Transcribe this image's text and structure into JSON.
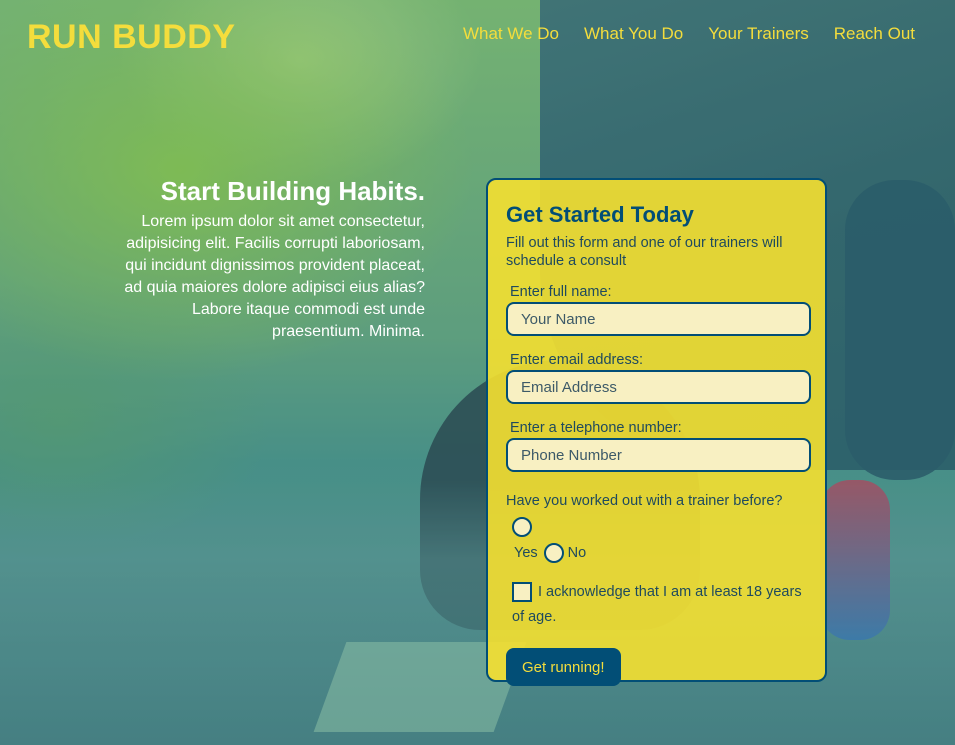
{
  "brand": {
    "logo": "RUN BUDDY"
  },
  "nav": [
    {
      "label": "What We Do"
    },
    {
      "label": "What You Do"
    },
    {
      "label": "Your Trainers"
    },
    {
      "label": "Reach Out"
    }
  ],
  "hero": {
    "title": "Start Building Habits.",
    "body": "Lorem ipsum dolor sit amet consectetur, adipisicing elit. Facilis corrupti laboriosam, qui incidunt dignissimos provident placeat, ad quia maiores dolore adipisci eius alias? Labore itaque commodi est unde praesentium. Minima."
  },
  "form": {
    "title": "Get Started Today",
    "subtitle": "Fill out this form and one of our trainers will schedule a consult",
    "name": {
      "label": "Enter full name:",
      "placeholder": "Your Name",
      "value": ""
    },
    "email": {
      "label": "Enter email address:",
      "placeholder": "Email Address",
      "value": ""
    },
    "phone": {
      "label": "Enter a telephone number:",
      "placeholder": "Phone Number",
      "value": ""
    },
    "trainer_question": "Have you worked out with a trainer before?",
    "yes_label": "Yes",
    "no_label": "No",
    "acknowledge": "I acknowledge that I am at least 18 years of age.",
    "submit_label": "Get running!"
  },
  "colors": {
    "accent": "#f4dd3c",
    "primary": "#024e76",
    "card": "#f5e030"
  }
}
